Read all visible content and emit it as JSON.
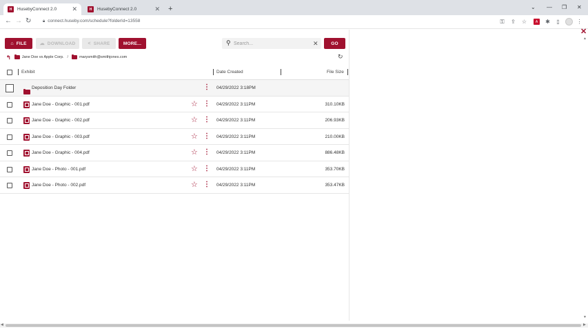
{
  "browser": {
    "tabs": [
      {
        "title": "HusebyConnect 2.0",
        "active": true
      },
      {
        "title": "HusebyConnect 2.0",
        "active": false
      }
    ],
    "new_tab": "+",
    "url": "connect.huseby.com/schedule?folderId=13558"
  },
  "toolbar": {
    "file_label": "FILE",
    "download_label": "DOWNLOAD",
    "share_label": "SHARE",
    "more_label": "MORE...",
    "go_label": "GO",
    "search_placeholder": "Search..."
  },
  "breadcrumb": {
    "items": [
      "Jane Doe vs Apple Corp.",
      "marysmith@smithjones.com"
    ],
    "separator": "/"
  },
  "table": {
    "columns": {
      "name": "Exhibit",
      "date": "Date Created",
      "size": "File Size"
    },
    "rows": [
      {
        "type": "folder",
        "name": "Deposition Day Folder",
        "date": "04/29/2022 3:18PM",
        "size": ""
      },
      {
        "type": "pdf",
        "name": "Jane Doe - Graphic - 001.pdf",
        "date": "04/29/2022 3:11PM",
        "size": "310.10KB"
      },
      {
        "type": "pdf",
        "name": "Jane Doe - Graphic - 002.pdf",
        "date": "04/29/2022 3:11PM",
        "size": "206.93KB"
      },
      {
        "type": "pdf",
        "name": "Jane Doe - Graphic - 003.pdf",
        "date": "04/29/2022 3:11PM",
        "size": "210.00KB"
      },
      {
        "type": "pdf",
        "name": "Jane Doe - Graphic - 004.pdf",
        "date": "04/29/2022 3:11PM",
        "size": "886.48KB"
      },
      {
        "type": "pdf",
        "name": "Jane Doe - Photo - 001.pdf",
        "date": "04/29/2022 3:11PM",
        "size": "353.70KB"
      },
      {
        "type": "pdf",
        "name": "Jane Doe - Photo - 002.pdf",
        "date": "04/29/2022 3:11PM",
        "size": "353.47KB"
      }
    ]
  },
  "colors": {
    "brand": "#a0112f",
    "disabled": "#e9e9e9"
  }
}
